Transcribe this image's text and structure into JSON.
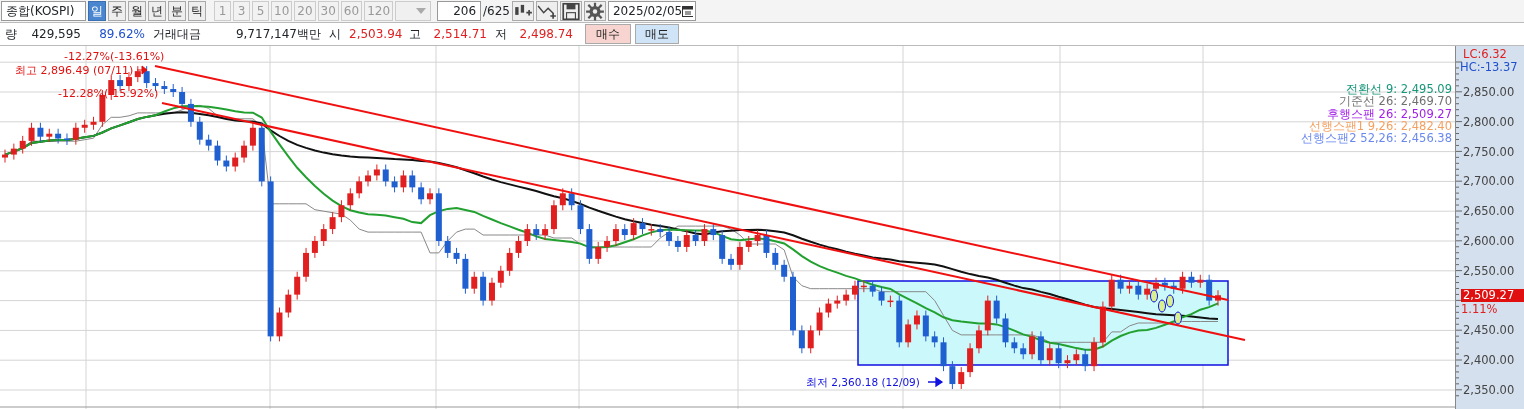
{
  "toolbar": {
    "symbol": "종합(KOSPI)",
    "periods": [
      {
        "label": "일",
        "selected": true
      },
      {
        "label": "주",
        "selected": false
      },
      {
        "label": "월",
        "selected": false
      },
      {
        "label": "년",
        "selected": false
      },
      {
        "label": "분",
        "selected": false
      },
      {
        "label": "틱",
        "selected": false
      }
    ],
    "intervals": [
      {
        "label": "1",
        "disabled": true
      },
      {
        "label": "3",
        "disabled": true
      },
      {
        "label": "5",
        "disabled": true
      },
      {
        "label": "10",
        "disabled": true
      },
      {
        "label": "20",
        "disabled": true
      },
      {
        "label": "30",
        "disabled": true
      },
      {
        "label": "60",
        "disabled": true
      },
      {
        "label": "120",
        "disabled": true
      }
    ],
    "count": "206",
    "total": "/625",
    "date": "2025/02/05"
  },
  "quote": {
    "volume_label": "량",
    "volume": "429,595",
    "volume_ratio": "89.62%",
    "amount_label": "거래대금",
    "amount": "9,717,147백만",
    "open_label": "시",
    "open": "2,503.94",
    "high_label": "고",
    "high": "2,514.71",
    "low_label": "저",
    "low": "2,498.74",
    "buy": "매수",
    "sell": "매도"
  },
  "chart": {
    "lc": "LC:6.32",
    "hc": "HC:-13.37",
    "current_price": "2,509.27",
    "change": "1.11%",
    "axis_labels": [
      "2,850.00",
      "2,800.00",
      "2,750.00",
      "2,700.00",
      "2,650.00",
      "2,600.00",
      "2,550.00",
      "2,450.00",
      "2,400.00",
      "2,350.00"
    ],
    "legend": [
      {
        "text": "전환선 9: 2,495.09",
        "color": "#16967a"
      },
      {
        "text": "기준선 26: 2,469.70",
        "color": "#707070"
      },
      {
        "text": "후행스팬 26: 2,509.27",
        "color": "#a01ee8"
      },
      {
        "text": "선행스팬1 9,26: 2,482.40",
        "color": "#f4a060"
      },
      {
        "text": "선행스팬2 52,26: 2,456.38",
        "color": "#6a88ee"
      }
    ],
    "annotations": [
      {
        "kind": "high",
        "text": "최고 2,896.49 (07/11)"
      },
      {
        "kind": "drop_top",
        "text": "-12.27%(-13.61%)"
      },
      {
        "kind": "drop_bottom",
        "text": "-12.28%(-15.92%)"
      },
      {
        "kind": "low",
        "text": "최저 2,360.18 (12/09)"
      }
    ]
  }
}
